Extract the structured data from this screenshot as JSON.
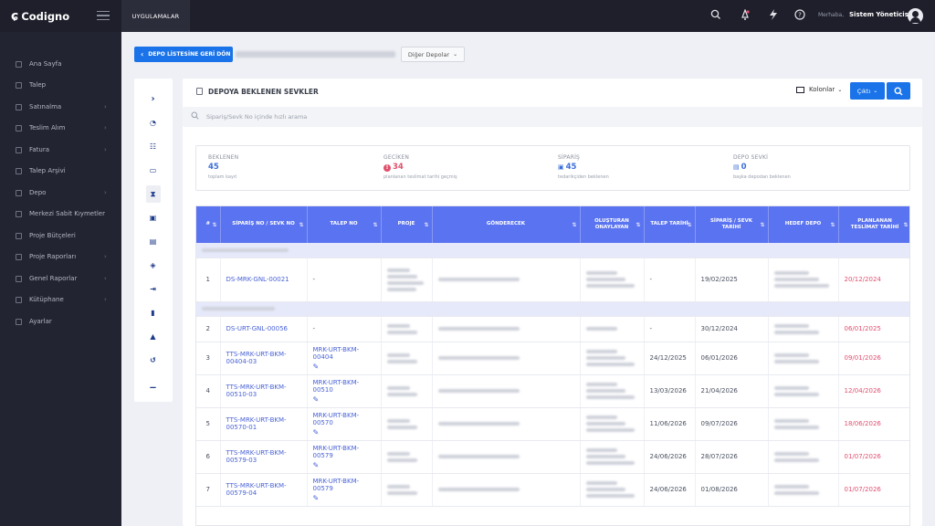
{
  "app": {
    "name": "Codigno",
    "apps_tab": "UYGULAMALAR"
  },
  "topbar": {
    "greeting": "Merhaba,",
    "user": "Sistem Yöneticisi",
    "icons": [
      "search-icon",
      "bell-icon",
      "lightning-icon",
      "help-icon"
    ]
  },
  "sidebar": {
    "items": [
      {
        "label": "Ana Sayfa",
        "chevron": false
      },
      {
        "label": "Talep",
        "chevron": false
      },
      {
        "label": "Satınalma",
        "chevron": true
      },
      {
        "label": "Teslim Alım",
        "chevron": true
      },
      {
        "label": "Fatura",
        "chevron": true
      },
      {
        "label": "Talep Arşivi",
        "chevron": false
      },
      {
        "label": "Depo",
        "chevron": true
      },
      {
        "label": "Merkezi Sabit Kıymetler",
        "chevron": false
      },
      {
        "label": "Proje Bütçeleri",
        "chevron": false
      },
      {
        "label": "Proje Raporları",
        "chevron": true
      },
      {
        "label": "Genel Raporlar",
        "chevron": true
      },
      {
        "label": "Kütüphane",
        "chevron": true
      },
      {
        "label": "Ayarlar",
        "chevron": false
      }
    ]
  },
  "toolbar": {
    "back_label": "DEPO LİSTESİNE GERİ DÖN",
    "other_depots": "Diğer Depolar"
  },
  "page": {
    "title": "DEPOYA BEKLENEN SEVKLER",
    "columns_btn": "Kolonlar",
    "print_btn": "Çıktı",
    "search_placeholder": "Sipariş/Sevk No içinde hızlı arama"
  },
  "stats": [
    {
      "title": "BEKLENEN",
      "value": "45",
      "desc": "toplam kayıt",
      "color": "#3b6fd8"
    },
    {
      "title": "GECİKEN",
      "value": "34",
      "desc": "planlanan teslimat tarihi geçmiş",
      "color": "#e0506c"
    },
    {
      "title": "SİPARİŞ",
      "value": "45",
      "desc": "tedarikçiden beklenen",
      "color": "#3b6fd8"
    },
    {
      "title": "DEPO SEVKİ",
      "value": "0",
      "desc": "başka depodan beklenen",
      "color": "#3b6fd8"
    }
  ],
  "table": {
    "headers": [
      "#",
      "SİPARİŞ NO / SEVK NO",
      "TALEP NO",
      "PROJE",
      "GÖNDERECEK",
      "OLUŞTURAN ONAYLAYAN",
      "TALEP TARİHİ",
      "SİPARİŞ / SEVK TARİHİ",
      "HEDEF DEPO",
      "PLANLANAN TESLİMAT TARİHİ"
    ],
    "rows": [
      {
        "idx": "1",
        "order": "DS-MRK-GNL-00021",
        "talep": "-",
        "talep_date": "-",
        "order_date": "19/02/2025",
        "planned": "20/12/2024",
        "editable": false
      },
      {
        "idx": "2",
        "order": "DS-URT-GNL-00056",
        "talep": "-",
        "talep_date": "-",
        "order_date": "30/12/2024",
        "planned": "06/01/2025",
        "editable": false
      },
      {
        "idx": "3",
        "order": "TTS-MRK-URT-BKM-00404-03",
        "talep": "MRK-URT-BKM-00404",
        "talep_date": "24/12/2025",
        "order_date": "06/01/2026",
        "planned": "09/01/2026",
        "editable": true
      },
      {
        "idx": "4",
        "order": "TTS-MRK-URT-BKM-00510-03",
        "talep": "MRK-URT-BKM-00510",
        "talep_date": "13/03/2026",
        "order_date": "21/04/2026",
        "planned": "12/04/2026",
        "editable": true
      },
      {
        "idx": "5",
        "order": "TTS-MRK-URT-BKM-00570-01",
        "talep": "MRK-URT-BKM-00570",
        "talep_date": "11/06/2026",
        "order_date": "09/07/2026",
        "planned": "18/06/2026",
        "editable": true
      },
      {
        "idx": "6",
        "order": "TTS-MRK-URT-BKM-00579-03",
        "talep": "MRK-URT-BKM-00579",
        "talep_date": "24/06/2026",
        "order_date": "28/07/2026",
        "planned": "01/07/2026",
        "editable": true
      },
      {
        "idx": "7",
        "order": "TTS-MRK-URT-BKM-00579-04",
        "talep": "MRK-URT-BKM-00579",
        "talep_date": "24/06/2026",
        "order_date": "01/08/2026",
        "planned": "01/07/2026",
        "editable": true
      }
    ]
  }
}
